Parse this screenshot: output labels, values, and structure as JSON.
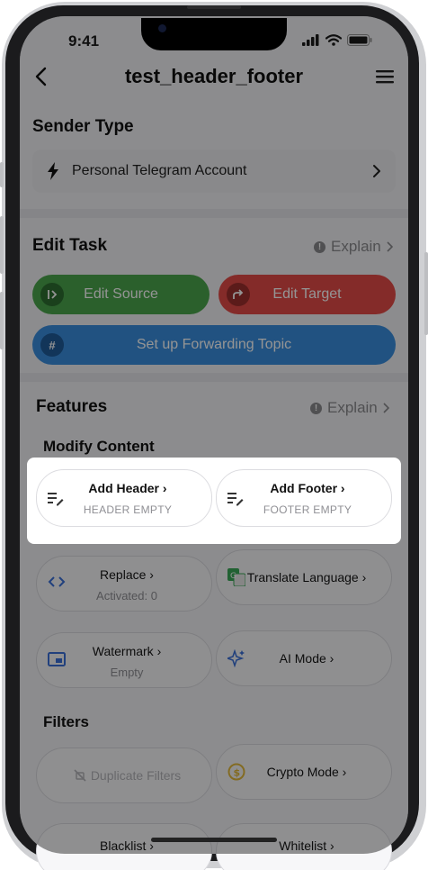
{
  "status_bar": {
    "time": "9:41"
  },
  "header": {
    "title": "test_header_footer"
  },
  "sender_type": {
    "title": "Sender Type",
    "value": "Personal Telegram Account"
  },
  "edit_task": {
    "title": "Edit Task",
    "explain": "Explain",
    "edit_source": "Edit Source",
    "edit_target": "Edit Target",
    "forwarding_topic": "Set up Forwarding Topic"
  },
  "features": {
    "title": "Features",
    "explain": "Explain",
    "modify_content": "Modify Content",
    "add_header": {
      "label": "Add Header",
      "status": "HEADER EMPTY"
    },
    "add_footer": {
      "label": "Add Footer",
      "status": "FOOTER EMPTY"
    },
    "replace": {
      "label": "Replace",
      "status": "Activated: 0"
    },
    "translate": {
      "label": "Translate Language"
    },
    "watermark": {
      "label": "Watermark",
      "status": "Empty"
    },
    "ai_mode": {
      "label": "AI Mode"
    },
    "filters_title": "Filters",
    "duplicate_filters": {
      "label": "Duplicate Filters"
    },
    "crypto_mode": {
      "label": "Crypto Mode"
    },
    "blacklist": {
      "label": "Blacklist"
    },
    "whitelist": {
      "label": "Whitelist"
    }
  },
  "colors": {
    "edit_source": "#4aa54c",
    "edit_target": "#e44b48",
    "forwarding_topic": "#3a8ede",
    "crypto_icon": "#e2b93b",
    "translate_icon": "#3aa757",
    "icon_blue": "#3a6fd8"
  },
  "icons": {
    "back": "chevron-left-icon",
    "menu": "hamburger-menu-icon",
    "sender": "lightning-bolt-icon",
    "header_footer": "text-edit-icon"
  }
}
